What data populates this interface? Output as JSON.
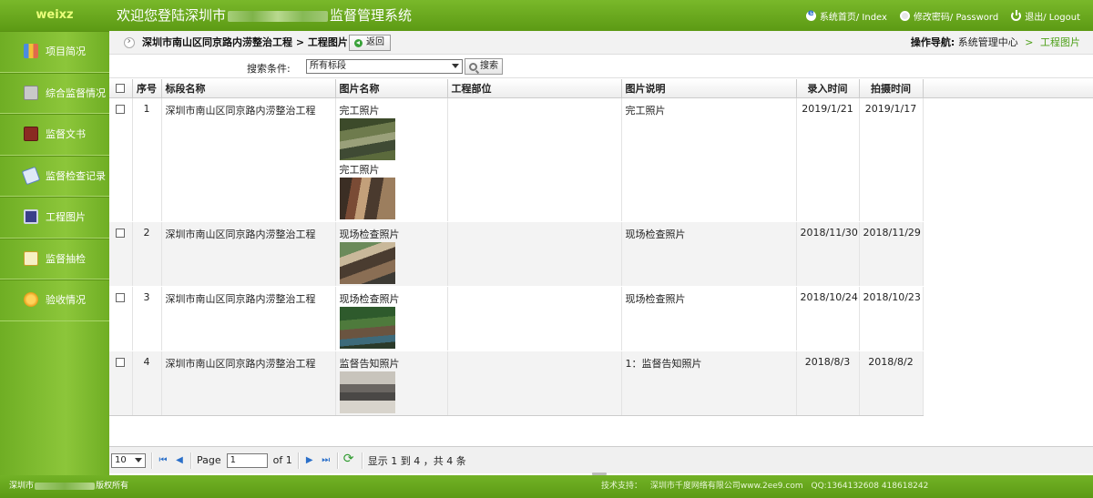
{
  "header": {
    "brand": "weixz",
    "title_prefix": "欢迎您登陆深圳市",
    "title_suffix": "监督管理系统",
    "links": {
      "home": "系统首页/ Index",
      "password": "修改密码/ Password",
      "logout": "退出/ Logout"
    }
  },
  "sidebar": {
    "items": [
      {
        "label": "项目简况",
        "icon": "chart-book-icon"
      },
      {
        "label": "综合监督情况",
        "icon": "calculator-icon"
      },
      {
        "label": "监督文书",
        "icon": "book-icon"
      },
      {
        "label": "监督检查记录",
        "icon": "pen-icon"
      },
      {
        "label": "工程图片",
        "icon": "monitor-icon"
      },
      {
        "label": "监督抽检",
        "icon": "note-icon"
      },
      {
        "label": "验收情况",
        "icon": "coins-icon"
      }
    ]
  },
  "breadcrumb": {
    "path": "深圳市南山区同京路内涝整治工程 > 工程图片",
    "back_label": "返回",
    "nav_label": "操作导航:",
    "nav_root": "系统管理中心",
    "nav_sep": ">",
    "nav_current": "工程图片"
  },
  "search": {
    "label": "搜索条件:",
    "select_value": "所有标段",
    "button_label": "搜索"
  },
  "table": {
    "columns": [
      "序号",
      "标段名称",
      "图片名称",
      "工程部位",
      "图片说明",
      "录入时间",
      "拍摄时间"
    ],
    "rows": [
      {
        "no": "1",
        "section": "深圳市南山区同京路内涝整治工程",
        "photos": [
          "完工照片",
          "完工照片"
        ],
        "part": "",
        "desc": "完工照片",
        "entered": "2019/1/21",
        "shot": "2019/1/17"
      },
      {
        "no": "2",
        "section": "深圳市南山区同京路内涝整治工程",
        "photos": [
          "现场检查照片"
        ],
        "part": "",
        "desc": "现场检查照片",
        "entered": "2018/11/30",
        "shot": "2018/11/29"
      },
      {
        "no": "3",
        "section": "深圳市南山区同京路内涝整治工程",
        "photos": [
          "现场检查照片"
        ],
        "part": "",
        "desc": "现场检查照片",
        "entered": "2018/10/24",
        "shot": "2018/10/23"
      },
      {
        "no": "4",
        "section": "深圳市南山区同京路内涝整治工程",
        "photos": [
          "监督告知照片"
        ],
        "part": "",
        "desc": "1：监督告知照片",
        "entered": "2018/8/3",
        "shot": "2018/8/2"
      }
    ]
  },
  "pager": {
    "page_size": "10",
    "page_label": "Page",
    "page_value": "1",
    "of_label": "of 1",
    "summary": "显示 1 到 4 ，共 4 条"
  },
  "footer": {
    "copyright_prefix": "深圳市",
    "copyright_suffix": "版权所有",
    "support_label": "技术支持：",
    "support_company": "深圳市千度网络有限公司www.2ee9.com",
    "support_qq": "QQ:1364132608 418618242"
  },
  "colors": {
    "brand_green": "#6fae24",
    "accent_green": "#4ea019",
    "link_blue": "#2a6fc9"
  }
}
